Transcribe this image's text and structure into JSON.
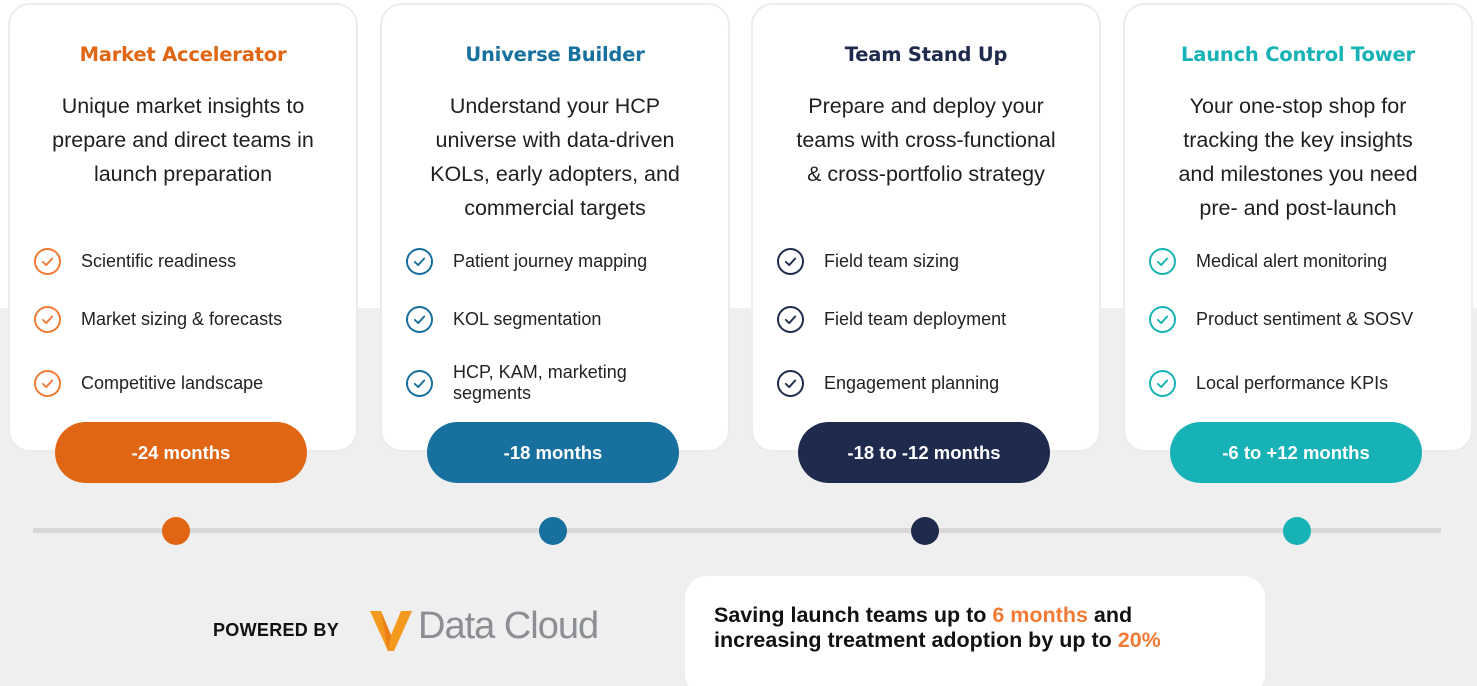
{
  "colors": {
    "orange": "#e06614",
    "blue": "#18709e",
    "navy": "#1e2b4d",
    "teal": "#17b2b6",
    "highlight": "#f27a35",
    "timeline": "#d8d8d8"
  },
  "cards": [
    {
      "title": "Market Accelerator",
      "desc": [
        "Unique market insights to",
        "prepare and direct teams in",
        "launch preparation"
      ],
      "items": [
        "Scientific readiness",
        "Market sizing & forecasts",
        "Competitive landscape"
      ],
      "timing": "-24 months",
      "icon": "check-circle-icon"
    },
    {
      "title": "Universe Builder",
      "desc": [
        "Understand your HCP",
        "universe with data-driven",
        "KOLs, early adopters, and",
        "commercial targets"
      ],
      "items": [
        "Patient journey mapping",
        "KOL segmentation",
        "HCP, KAM, marketing segments"
      ],
      "timing": "-18 months",
      "icon": "check-circle-icon"
    },
    {
      "title": "Team Stand Up",
      "desc": [
        "Prepare and deploy your",
        "teams with cross-functional",
        "& cross-portfolio strategy"
      ],
      "items": [
        "Field team sizing",
        "Field team deployment",
        "Engagement planning"
      ],
      "timing": "-18 to -12 months",
      "icon": "check-circle-icon"
    },
    {
      "title": "Launch Control Tower",
      "desc": [
        "Your one-stop shop for",
        "tracking the key insights",
        "and milestones you need",
        "pre- and post-launch"
      ],
      "items": [
        "Medical alert monitoring",
        "Product sentiment & SOSV",
        "Local performance KPIs"
      ],
      "timing": "-6 to +12 months",
      "icon": "check-circle-icon"
    }
  ],
  "footer": {
    "powered_by": "POWERED BY",
    "brand_name": "Data Cloud",
    "brand_icon": "v-logo-icon",
    "stat": {
      "line1_prefix": "Saving launch teams up to ",
      "line1_highlight": "6 months",
      "line1_suffix": " and",
      "line2_prefix": "increasing treatment adoption by up to ",
      "line2_highlight": "20%"
    }
  }
}
